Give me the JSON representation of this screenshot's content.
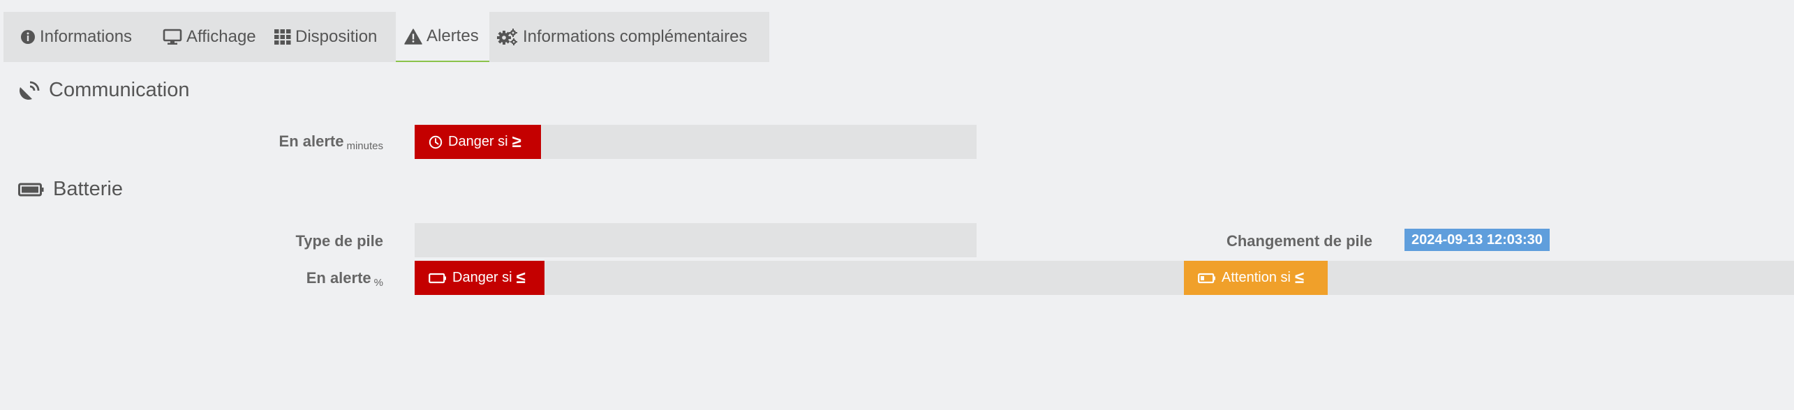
{
  "tabs": [
    {
      "label": "Informations",
      "icon": "info-circle-icon",
      "active": false
    },
    {
      "label": "Affichage",
      "icon": "monitor-icon",
      "active": false
    },
    {
      "label": "Disposition",
      "icon": "grid-icon",
      "active": false
    },
    {
      "label": "Alertes",
      "icon": "warning-icon",
      "active": true
    },
    {
      "label": "Informations complémentaires",
      "icon": "gears-icon",
      "active": false
    }
  ],
  "communication": {
    "title": "Communication",
    "icon": "satellite-icon",
    "alert_label": "En alerte",
    "alert_unit": "minutes",
    "danger_label": "Danger si",
    "danger_symbol": "≥",
    "danger_icon": "clock-icon",
    "danger_value": ""
  },
  "batterie": {
    "title": "Batterie",
    "icon": "battery-full-icon",
    "type_label": "Type de pile",
    "type_value": "",
    "change_label": "Changement de pile",
    "change_value": "2024-09-13 12:03:30",
    "alert_label": "En alerte",
    "alert_unit": "%",
    "danger_label": "Danger si",
    "danger_symbol": "≤",
    "danger_icon": "battery-empty-icon",
    "danger_value": "",
    "warning_label": "Attention si",
    "warning_symbol": "≤",
    "warning_icon": "battery-low-icon",
    "warning_value": ""
  },
  "colors": {
    "accent_active_tab": "#8bc34a",
    "danger": "#c40000",
    "warning": "#f0a02a",
    "date_badge": "#5f9edc",
    "background": "#eff0f2",
    "field": "#e1e2e3"
  }
}
